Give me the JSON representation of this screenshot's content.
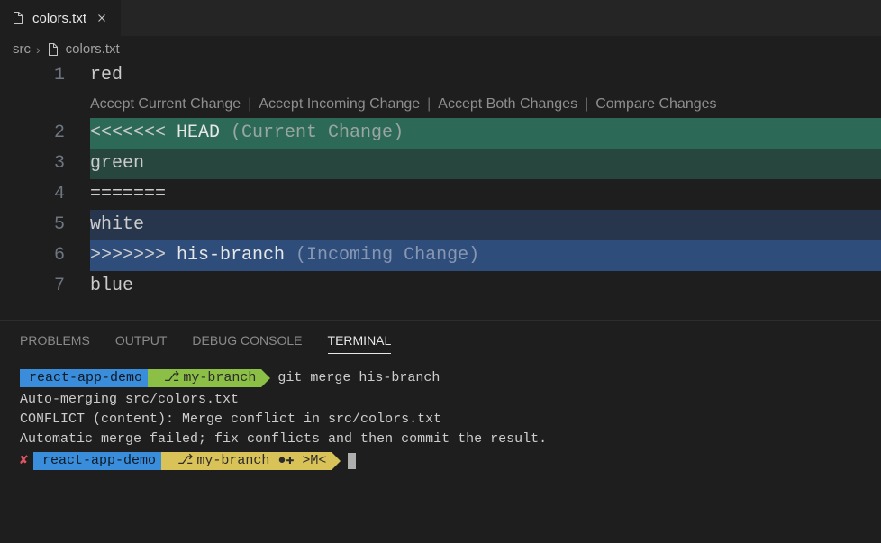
{
  "tab": {
    "filename": "colors.txt"
  },
  "breadcrumbs": {
    "folder": "src",
    "file": "colors.txt"
  },
  "codelens": {
    "accept_current": "Accept Current Change",
    "accept_incoming": "Accept Incoming Change",
    "accept_both": "Accept Both Changes",
    "compare": "Compare Changes"
  },
  "lines": {
    "l1": {
      "num": "1",
      "text": "red"
    },
    "l2": {
      "num": "2",
      "marker": "<<<<<<< ",
      "head": "HEAD",
      "label": " (Current Change)"
    },
    "l3": {
      "num": "3",
      "text": "green"
    },
    "l4": {
      "num": "4",
      "text": "======="
    },
    "l5": {
      "num": "5",
      "text": "white"
    },
    "l6": {
      "num": "6",
      "marker": ">>>>>>> ",
      "branch": "his-branch",
      "label": " (Incoming Change)"
    },
    "l7": {
      "num": "7",
      "text": "blue"
    }
  },
  "panel_tabs": {
    "problems": "PROBLEMS",
    "output": "OUTPUT",
    "debug": "DEBUG CONSOLE",
    "terminal": "TERMINAL"
  },
  "terminal": {
    "prompt1": {
      "repo": "react-app-demo",
      "branch": "my-branch",
      "cmd": "git merge his-branch"
    },
    "out1": "Auto-merging src/colors.txt",
    "out2": "CONFLICT (content): Merge conflict in src/colors.txt",
    "out3": "Automatic merge failed; fix conflicts and then commit the result.",
    "prompt2": {
      "repo": "react-app-demo",
      "branch": "my-branch ●✚ >M<"
    }
  }
}
